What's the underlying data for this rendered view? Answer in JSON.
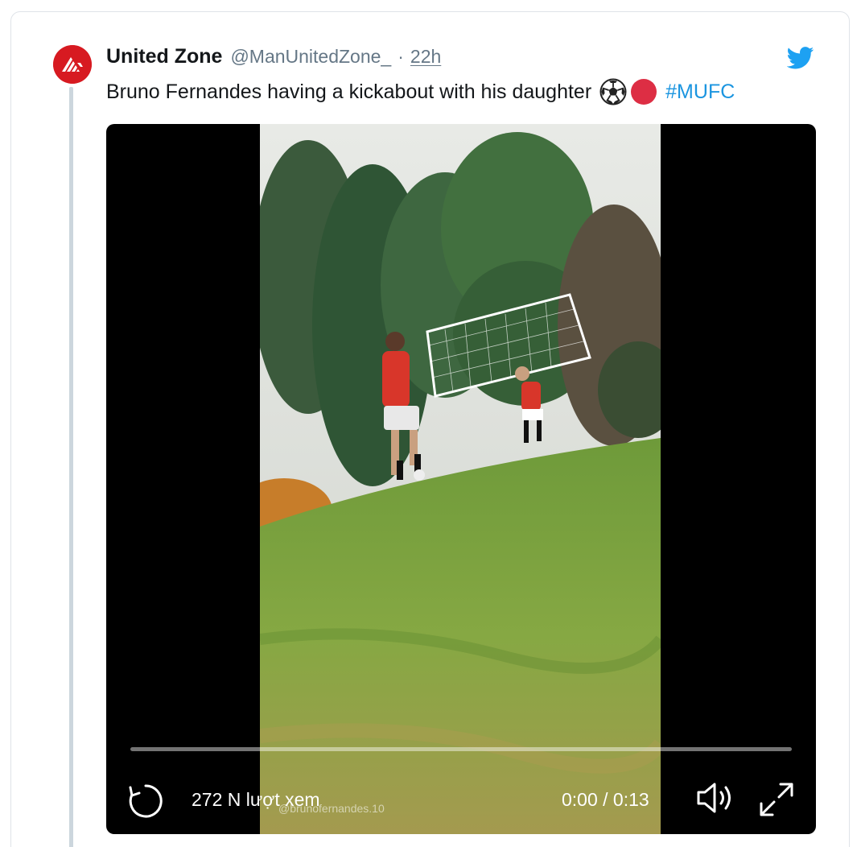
{
  "tweet": {
    "display_name": "United Zone",
    "handle": "@ManUnitedZone_",
    "separator": "·",
    "time": "22h",
    "text": "Bruno Fernandes having a kickabout with his daughter",
    "emoji_1": "soccer-ball",
    "emoji_2": "red-circle",
    "hashtag": "#MUFC"
  },
  "video": {
    "views": "272 N lượt xem",
    "watermark": "@brunofernandes.10",
    "timecode": "0:00 / 0:13",
    "progress": 0
  },
  "colors": {
    "brand_red": "#d71a21",
    "twitter_blue": "#1b95e0",
    "text": "#14171a",
    "muted": "#657786"
  },
  "icons": {
    "avatar": "united-zone-logo",
    "brand": "twitter-bird-icon",
    "replay": "replay-icon",
    "volume": "volume-icon",
    "fullscreen": "fullscreen-icon"
  }
}
